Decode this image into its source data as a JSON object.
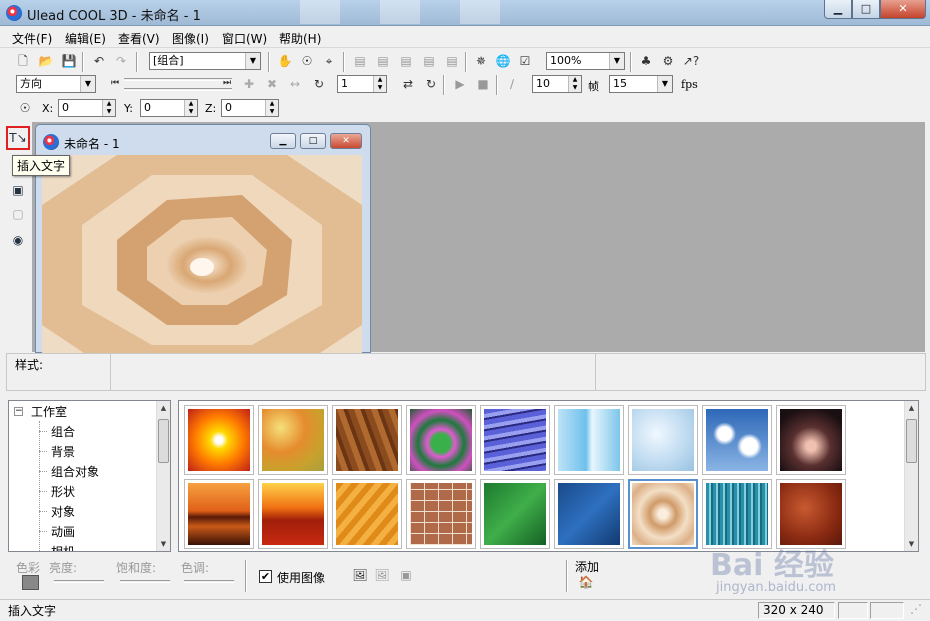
{
  "window": {
    "title": "Ulead COOL 3D - 未命名 - 1"
  },
  "menu": [
    "文件(F)",
    "编辑(E)",
    "查看(V)",
    "图像(I)",
    "窗口(W)",
    "帮助(H)"
  ],
  "toolbar1": {
    "object_combo": "[组合]",
    "zoom_combo": "100%"
  },
  "toolbar2": {
    "direction_combo": "方向",
    "frame_value": "1",
    "speed_value": "10",
    "frame_label": "帧",
    "fps_value": "15",
    "fps_label": "fps"
  },
  "toolbar3": {
    "x_label": "X:",
    "x_value": "0",
    "y_label": "Y:",
    "y_value": "0",
    "z_label": "Z:",
    "z_value": "0"
  },
  "tooltip": "插入文字",
  "document": {
    "title": "未命名 - 1"
  },
  "style_bar": {
    "label": "样式:"
  },
  "tree": {
    "root": "工作室",
    "items": [
      "组合",
      "背景",
      "组合对象",
      "形状",
      "对象",
      "动画",
      "相机"
    ]
  },
  "thumbnails_row1": [
    "sunburst",
    "marble-yellow",
    "wood-grain",
    "swirl-green",
    "water-blue",
    "ice-blue",
    "frost-light",
    "clouds-blue",
    "dark-clouds"
  ],
  "thumbnails_row2": [
    "sunset-sea",
    "sunset-red",
    "sand-orange",
    "brick-wall",
    "green-fabric",
    "blue-stone",
    "spiral-tan",
    "water-cyan",
    "red-rock"
  ],
  "selected_thumbnail": "spiral-tan",
  "adjust": {
    "color_label": "色彩",
    "brightness_label": "亮度:",
    "saturation_label": "饱和度:",
    "hue_label": "色调:",
    "use_image_label": "使用图像",
    "use_image_checked": "✔",
    "add_label": "添加"
  },
  "status": {
    "text": "插入文字",
    "size": "320 x 240"
  },
  "watermark": {
    "brand": "Bai  经验",
    "url": "jingyan.baidu.com"
  },
  "colors": {
    "workspace": "#ababab",
    "highlight": "#e02020",
    "selection": "#5a8fd0"
  }
}
